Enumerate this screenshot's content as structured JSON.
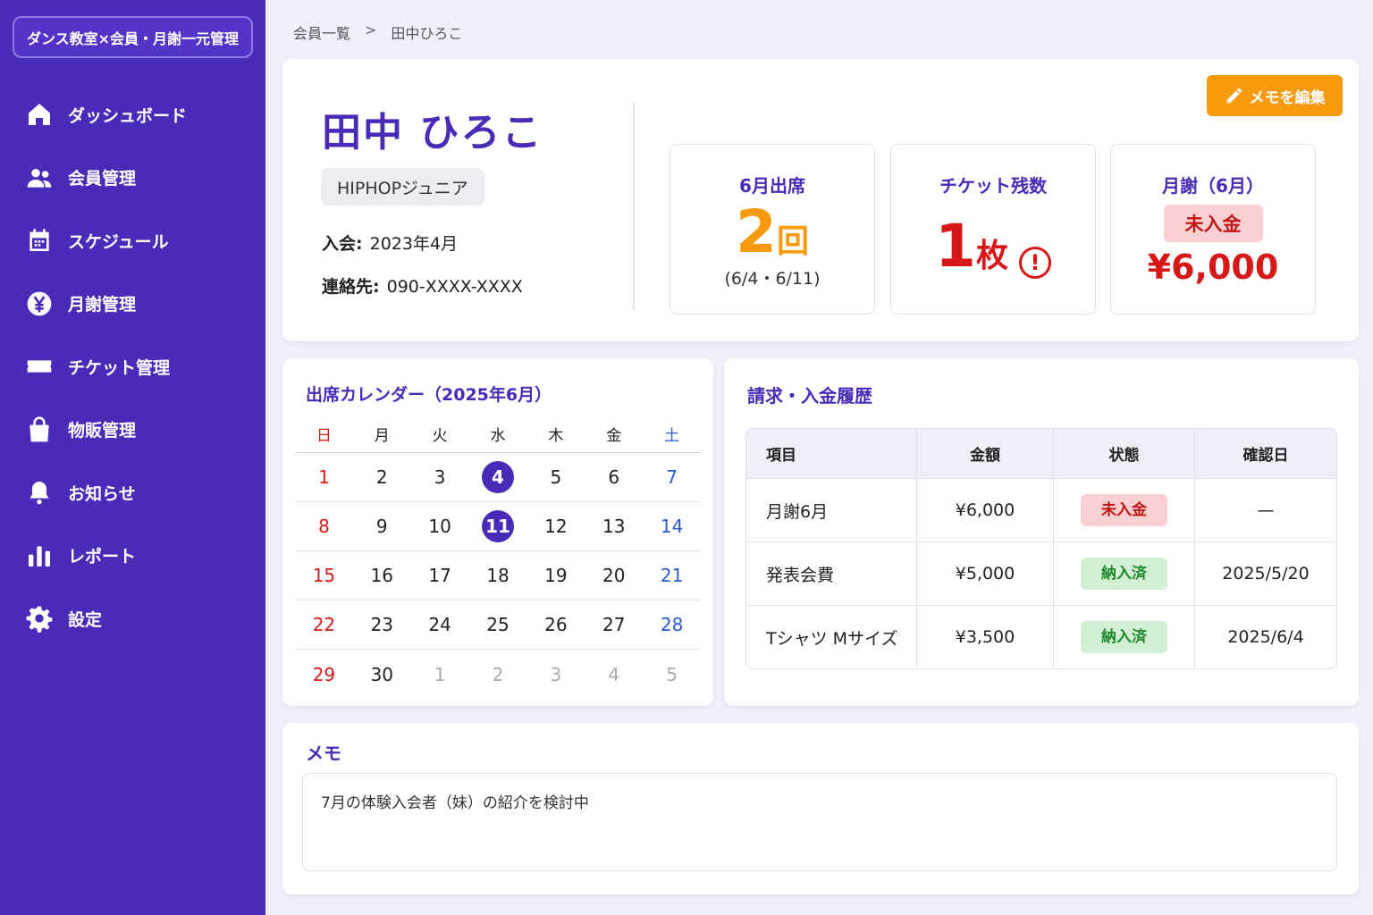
{
  "app": {
    "brand": "ダンス教室×会員・月謝一元管理"
  },
  "sidebar": {
    "items": [
      {
        "label": "ダッシュボード",
        "icon": "home-icon"
      },
      {
        "label": "会員管理",
        "icon": "users-icon"
      },
      {
        "label": "スケジュール",
        "icon": "calendar-icon"
      },
      {
        "label": "月謝管理",
        "icon": "yen-icon"
      },
      {
        "label": "チケット管理",
        "icon": "ticket-icon"
      },
      {
        "label": "物販管理",
        "icon": "shopping-bag-icon"
      },
      {
        "label": "お知らせ",
        "icon": "bell-icon"
      },
      {
        "label": "レポート",
        "icon": "bar-chart-icon"
      },
      {
        "label": "設定",
        "icon": "gear-icon"
      }
    ]
  },
  "breadcrumb": {
    "parent": "会員一覧",
    "separator": ">",
    "current": "田中ひろこ"
  },
  "profile": {
    "name": "田中 ひろこ",
    "class_tag": "HIPHOPジュニア",
    "joined_label": "入会:",
    "joined_value": "2023年4月",
    "contact_label": "連絡先:",
    "contact_value": "090-XXXX-XXXX",
    "edit_button": "メモを編集"
  },
  "stats": {
    "attendance": {
      "title": "6月出席",
      "value": "2",
      "unit": "回",
      "sub": "(6/4・6/11)"
    },
    "tickets": {
      "title": "チケット残数",
      "value": "1",
      "unit": "枚",
      "alert": "!"
    },
    "fee": {
      "title": "月謝（6月）",
      "status": "未入金",
      "amount": "¥6,000"
    }
  },
  "calendar": {
    "title": "出席カレンダー（2025年6月）",
    "weekdays": [
      "日",
      "月",
      "火",
      "水",
      "木",
      "金",
      "土"
    ],
    "weeks": [
      [
        "1",
        "2",
        "3",
        "4",
        "5",
        "6",
        "7"
      ],
      [
        "8",
        "9",
        "10",
        "11",
        "12",
        "13",
        "14"
      ],
      [
        "15",
        "16",
        "17",
        "18",
        "19",
        "20",
        "21"
      ],
      [
        "22",
        "23",
        "24",
        "25",
        "26",
        "27",
        "28"
      ],
      [
        "29",
        "30",
        "1",
        "2",
        "3",
        "4",
        "5"
      ]
    ],
    "attended_days": [
      "4",
      "11"
    ]
  },
  "billing": {
    "title": "請求・入金履歴",
    "headers": [
      "項目",
      "金額",
      "状態",
      "確認日"
    ],
    "rows": [
      {
        "item": "月謝6月",
        "amount": "¥6,000",
        "status": "未入金",
        "date": "—"
      },
      {
        "item": "発表会費",
        "amount": "¥5,000",
        "status": "納入済",
        "date": "2025/5/20"
      },
      {
        "item": "Tシャツ Mサイズ",
        "amount": "¥3,500",
        "status": "納入済",
        "date": "2025/6/4"
      }
    ]
  },
  "memo": {
    "title": "メモ",
    "text": "7月の体験入会者（妹）の紹介を検討中"
  },
  "colors": {
    "primary": "#4a2bb8",
    "accent": "#f79a0e",
    "danger": "#d81818",
    "success": "#1e8a2c"
  }
}
